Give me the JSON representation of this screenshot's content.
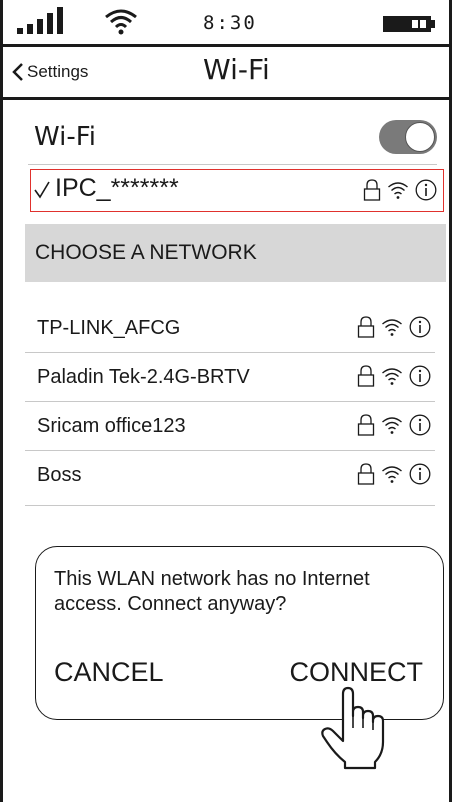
{
  "status_bar": {
    "time": "8:30",
    "signal_icon": "signal-bars-icon",
    "wifi_icon": "wifi-icon",
    "battery_icon": "battery-icon"
  },
  "nav": {
    "back_label": "Settings",
    "back_icon": "chevron-left-icon",
    "title": "Wi-Fi"
  },
  "wifi_toggle": {
    "label": "Wi-Fi",
    "on": true
  },
  "connected_network": {
    "name": "IPC_*******",
    "check_icon": "checkmark-icon",
    "icons": [
      "lock-icon",
      "wifi-icon",
      "info-icon"
    ]
  },
  "section_header": "CHOOSE A NETWORK",
  "networks": [
    {
      "name": "TP-LINK_AFCG"
    },
    {
      "name": "Paladin Tek-2.4G-BRTV"
    },
    {
      "name": "Sricam office123"
    },
    {
      "name": "Boss"
    }
  ],
  "dialog": {
    "message": "This WLAN network has no Internet access. Connect anyway?",
    "cancel_label": "CANCEL",
    "connect_label": "CONNECT"
  },
  "colors": {
    "highlight_border": "#e0312d",
    "section_bg": "#d7d7d7",
    "toggle_on": "#7a7a7a"
  },
  "pointer_icon": "hand-pointer-icon"
}
